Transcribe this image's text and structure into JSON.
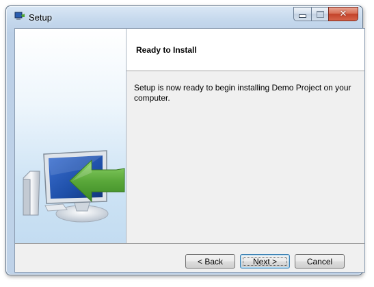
{
  "window": {
    "title": "Setup"
  },
  "caption_buttons": {
    "minimize_icon": "minimize-icon",
    "maximize_icon": "maximize-icon",
    "close_glyph": "✕"
  },
  "header": {
    "title": "Ready to Install"
  },
  "content": {
    "message": "Setup is now ready to begin installing Demo Project on your computer."
  },
  "buttons": {
    "back": "< Back",
    "next": "Next >",
    "cancel": "Cancel"
  },
  "illustration": {
    "icon": "computer-install-arrow-icon",
    "arrow_color": "#5aa83a",
    "screen_color": "#1e4fa8"
  }
}
